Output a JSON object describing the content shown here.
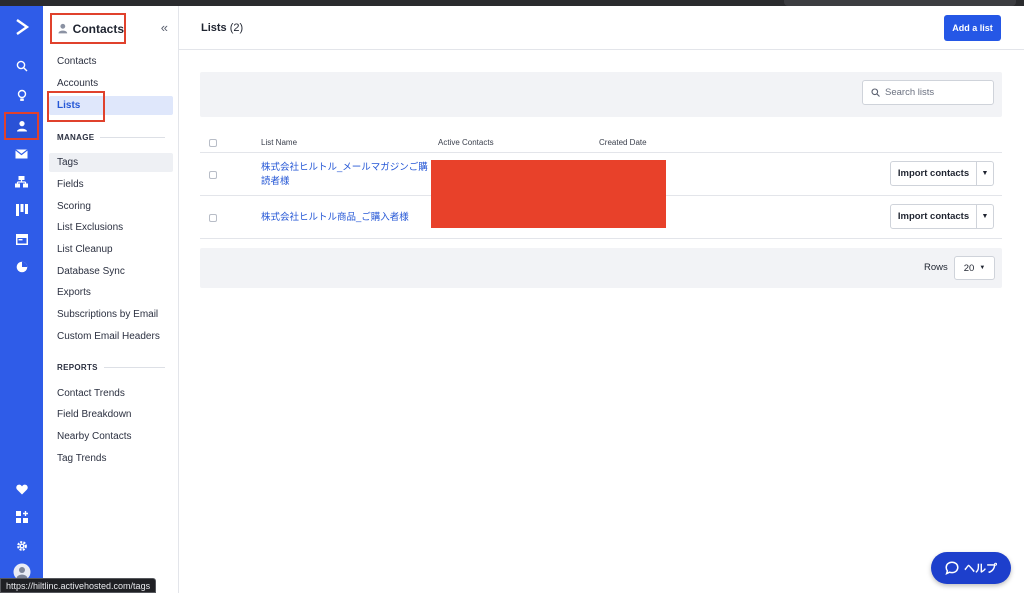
{
  "sidebar": {
    "title": "Contacts",
    "collapse_glyph": "«",
    "items": [
      {
        "label": "Contacts"
      },
      {
        "label": "Accounts"
      },
      {
        "label": "Lists"
      }
    ],
    "manage_heading": "MANAGE",
    "manage_items": [
      {
        "label": "Tags"
      },
      {
        "label": "Fields"
      },
      {
        "label": "Scoring"
      },
      {
        "label": "List Exclusions"
      },
      {
        "label": "List Cleanup"
      },
      {
        "label": "Database Sync"
      },
      {
        "label": "Exports"
      },
      {
        "label": "Subscriptions by Email"
      },
      {
        "label": "Custom Email Headers"
      }
    ],
    "reports_heading": "REPORTS",
    "reports_items": [
      {
        "label": "Contact Trends"
      },
      {
        "label": "Field Breakdown"
      },
      {
        "label": "Nearby Contacts"
      },
      {
        "label": "Tag Trends"
      }
    ]
  },
  "rail": {
    "icons": [
      "logo-chevron-icon",
      "search-icon",
      "lightbulb-icon",
      "contacts-person-icon",
      "email-icon",
      "automation-icon",
      "deals-board-icon",
      "website-icon",
      "reports-pie-icon",
      "heart-icon",
      "apps-icon",
      "settings-gear-icon",
      "user-avatar-icon"
    ]
  },
  "main": {
    "title": "Lists",
    "count": "(2)",
    "add_button": "Add a list",
    "search_placeholder": "Search lists",
    "columns": {
      "name": "List Name",
      "active": "Active Contacts",
      "created": "Created Date"
    },
    "rows": [
      {
        "name": "株式会社ヒルトル_メールマガジンご購読者様",
        "action": "Import contacts"
      },
      {
        "name": "株式会社ヒルトル商品_ご購入者様",
        "action": "Import contacts"
      }
    ],
    "rows_label": "Rows",
    "rows_value": "20"
  },
  "help_button": "ヘルプ",
  "status_url": "https://hiltlinc.activehosted.com/tags",
  "colors": {
    "rail": "#2f5ce8",
    "primary": "#2557e6",
    "link": "#2557d6",
    "highlight_box": "#e0412c",
    "redaction": "#e8412a"
  }
}
